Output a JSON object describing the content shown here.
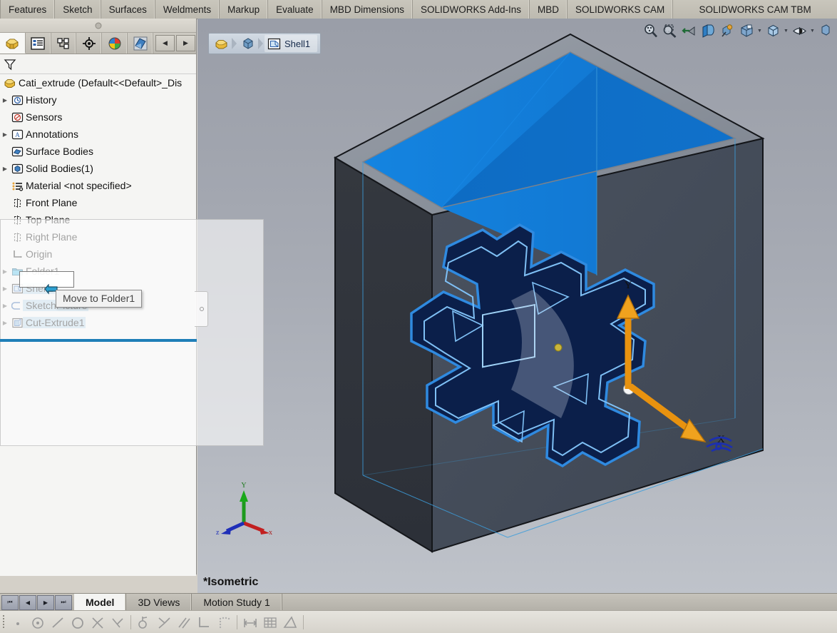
{
  "ribbon": {
    "tabs": [
      {
        "label": "Features"
      },
      {
        "label": "Sketch"
      },
      {
        "label": "Surfaces"
      },
      {
        "label": "Weldments"
      },
      {
        "label": "Markup"
      },
      {
        "label": "Evaluate"
      },
      {
        "label": "MBD Dimensions"
      },
      {
        "label": "SOLIDWORKS Add-Ins"
      },
      {
        "label": "MBD"
      },
      {
        "label": "SOLIDWORKS CAM"
      },
      {
        "label": "SOLIDWORKS CAM TBM"
      }
    ]
  },
  "left_panel": {
    "tabs": [
      {
        "name": "feature-manager-tab",
        "icon": "feature-tree-icon"
      },
      {
        "name": "property-manager-tab",
        "icon": "property-list-icon"
      },
      {
        "name": "configuration-manager-tab",
        "icon": "configuration-icon"
      },
      {
        "name": "dimxpert-manager-tab",
        "icon": "target-icon"
      },
      {
        "name": "display-manager-tab",
        "icon": "color-sphere-icon"
      },
      {
        "name": "cam-feature-tree-tab",
        "icon": "cam-tree-icon"
      }
    ],
    "nav_prev": "◀",
    "nav_next": "▶",
    "filter_icon": "filter-funnel-icon",
    "tree": {
      "root": {
        "label": "Cati_extrude  (Default<<Default>_Dis",
        "icon": "part-icon"
      },
      "items": [
        {
          "label": "History",
          "icon": "history-icon",
          "expandable": true,
          "indent": 0,
          "selected": false
        },
        {
          "label": "Sensors",
          "icon": "sensors-icon",
          "expandable": false,
          "indent": 0,
          "selected": false
        },
        {
          "label": "Annotations",
          "icon": "annotations-icon",
          "expandable": true,
          "indent": 0,
          "selected": false
        },
        {
          "label": "Surface Bodies",
          "icon": "surface-bodies-icon",
          "expandable": false,
          "indent": 0,
          "selected": false
        },
        {
          "label": "Solid Bodies(1)",
          "icon": "solid-bodies-icon",
          "expandable": true,
          "indent": 0,
          "selected": false
        },
        {
          "label": "Material <not specified>",
          "icon": "material-icon",
          "expandable": false,
          "indent": 0,
          "selected": false
        },
        {
          "label": "Front Plane",
          "icon": "plane-icon",
          "expandable": false,
          "indent": 0,
          "selected": false
        },
        {
          "label": "Top Plane",
          "icon": "plane-icon",
          "expandable": false,
          "indent": 0,
          "selected": false
        },
        {
          "label": "Right Plane",
          "icon": "plane-icon",
          "expandable": false,
          "indent": 0,
          "selected": false
        },
        {
          "label": "Origin",
          "icon": "origin-icon",
          "expandable": false,
          "indent": 0,
          "selected": false
        },
        {
          "label": "Folder1",
          "icon": "folder-icon",
          "expandable": true,
          "indent": 0,
          "selected": false
        },
        {
          "label": "Shell1",
          "icon": "shell-icon",
          "expandable": true,
          "indent": 0,
          "selected": true
        },
        {
          "label": "SketchPicture",
          "icon": "sketch-picture-icon",
          "expandable": true,
          "indent": 0,
          "selected": true
        },
        {
          "label": "Cut-Extrude1",
          "icon": "cut-extrude-icon",
          "expandable": true,
          "indent": 0,
          "selected": true
        }
      ]
    },
    "scrollbar": {
      "left_arrow": "‹",
      "right_arrow": "›"
    }
  },
  "drag": {
    "tooltip": "Move to Folder1",
    "cursor": "move-to-folder-cursor"
  },
  "graphics": {
    "breadcrumb": [
      {
        "icon": "part-icon",
        "label": ""
      },
      {
        "icon": "solid-body-icon",
        "label": ""
      },
      {
        "icon": "shell-icon",
        "label": "Shell1"
      }
    ],
    "view_toolbar": [
      {
        "name": "zoom-to-fit-button",
        "icon": "zoom-to-fit-icon",
        "caret": false
      },
      {
        "name": "zoom-to-area-button",
        "icon": "zoom-area-icon",
        "caret": false
      },
      {
        "name": "previous-view-button",
        "icon": "previous-view-icon",
        "caret": false
      },
      {
        "name": "section-view-button",
        "icon": "section-view-icon",
        "caret": false
      },
      {
        "name": "view-orientation-button",
        "icon": "view-orientation-icon",
        "caret": false
      },
      {
        "name": "display-style-button",
        "icon": "display-style-icon",
        "caret": true
      },
      {
        "name": "hide-show-items-button",
        "icon": "hide-show-cube-icon",
        "caret": true
      },
      {
        "name": "apply-scene-button",
        "icon": "scene-eye-icon",
        "caret": true
      },
      {
        "name": "view-settings-button",
        "icon": "view-settings-icon",
        "caret": false
      }
    ],
    "view_label": "*Isometric",
    "triad": {
      "x_label": "x",
      "y_label": "Y",
      "z_label": "z"
    }
  },
  "bottom": {
    "nav_buttons": [
      "⏮",
      "◀",
      "▶",
      "⏭"
    ],
    "tabs": [
      {
        "label": "Model",
        "active": true
      },
      {
        "label": "3D Views",
        "active": false
      },
      {
        "label": "Motion Study 1",
        "active": false
      }
    ]
  },
  "statusbar": {
    "tools": [
      {
        "name": "point-tool",
        "icon": "point-icon"
      },
      {
        "name": "concentric-tool",
        "icon": "concentric-icon"
      },
      {
        "name": "line-tool",
        "icon": "line-icon"
      },
      {
        "name": "circle-tool",
        "icon": "circle-icon"
      },
      {
        "name": "coincident-tool",
        "icon": "coincident-icon"
      },
      {
        "name": "midpoint-tool",
        "icon": "midpoint-icon"
      },
      {
        "name": "tangent-tool",
        "icon": "tangent-icon"
      },
      {
        "name": "equal-tool",
        "icon": "equal-icon"
      },
      {
        "name": "parallel-tool",
        "icon": "parallel-icon"
      },
      {
        "name": "perpendicular-tool",
        "icon": "perpendicular-icon"
      },
      {
        "name": "pattern-tool",
        "icon": "pattern-icon"
      },
      {
        "name": "dimension-tool",
        "icon": "dimension-icon"
      },
      {
        "name": "grid-tool",
        "icon": "grid-icon"
      },
      {
        "name": "angle-tool",
        "icon": "angle-icon"
      }
    ]
  },
  "colors": {
    "selection_blue": "#b8d4e8",
    "drop_indicator": "#1f7fb8",
    "top_face_blue": "#1279d4",
    "ribbon_bg": "#c9c6bc",
    "graphics_bg": "#a4a8b1"
  }
}
